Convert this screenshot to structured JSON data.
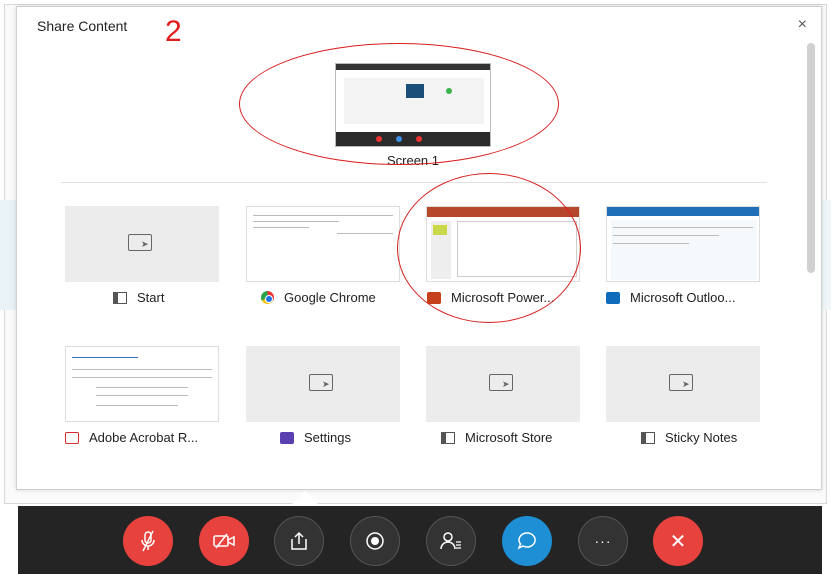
{
  "dialog": {
    "title": "Share Content",
    "close_glyph": "×",
    "step_number": "2"
  },
  "screens": [
    {
      "label": "Screen 1"
    }
  ],
  "apps": [
    {
      "label": "Start",
      "icon": "window-icon",
      "thumb": "blank"
    },
    {
      "label": "Google Chrome",
      "icon": "chrome-icon",
      "thumb": "screenshot"
    },
    {
      "label": "Microsoft Power...",
      "icon": "powerpoint-icon",
      "thumb": "screenshot"
    },
    {
      "label": "Microsoft Outloo...",
      "icon": "outlook-icon",
      "thumb": "screenshot"
    },
    {
      "label": "Adobe Acrobat R...",
      "icon": "acrobat-icon",
      "thumb": "screenshot"
    },
    {
      "label": "Settings",
      "icon": "settings-icon",
      "thumb": "blank"
    },
    {
      "label": "Microsoft Store",
      "icon": "window-icon",
      "thumb": "blank"
    },
    {
      "label": "Sticky Notes",
      "icon": "window-icon",
      "thumb": "blank"
    }
  ],
  "toolbar": {
    "buttons": [
      {
        "name": "mute-button",
        "icon": "microphone-muted-icon",
        "color": "#e8423e"
      },
      {
        "name": "video-off-button",
        "icon": "camera-off-icon",
        "color": "#e8423e"
      },
      {
        "name": "share-button",
        "icon": "share-icon",
        "color": "#333333"
      },
      {
        "name": "record-button",
        "icon": "record-icon",
        "color": "#333333"
      },
      {
        "name": "participants-button",
        "icon": "participants-icon",
        "color": "#333333"
      },
      {
        "name": "chat-button",
        "icon": "chat-icon",
        "color": "#1e8fd4"
      },
      {
        "name": "more-button",
        "icon": "more-icon",
        "color": "#333333"
      },
      {
        "name": "leave-button",
        "icon": "close-icon",
        "color": "#e8423e"
      }
    ],
    "more_glyph": "···",
    "leave_glyph": "✕"
  },
  "colors": {
    "annotation": "#d81e1e",
    "toolbar_bg": "#242424"
  }
}
